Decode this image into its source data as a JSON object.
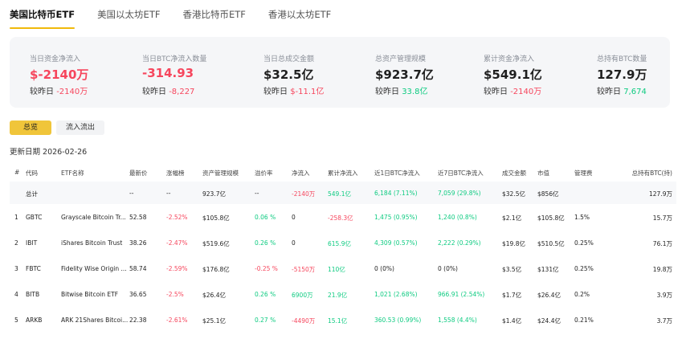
{
  "tabs": [
    "美国比特币ETF",
    "美国以太坊ETF",
    "香港比特币ETF",
    "香港以太坊ETF"
  ],
  "colors": {
    "up": "#0ecb81",
    "down": "#f6465d",
    "accent": "#f0b90b"
  },
  "summary": [
    {
      "label": "当日资金净流入",
      "value": "$-2140万",
      "cmp_label": "较昨日",
      "cmp_value": "-2140万",
      "value_color": "red",
      "cmp_color": "red"
    },
    {
      "label": "当日BTC净流入数量",
      "value": "-314.93",
      "cmp_label": "较昨日",
      "cmp_value": "-8,227",
      "value_color": "red",
      "cmp_color": "red"
    },
    {
      "label": "当日总成交金额",
      "value": "$32.5亿",
      "cmp_label": "较昨日",
      "cmp_value": "$-11.1亿",
      "value_color": "dark",
      "cmp_color": "red"
    },
    {
      "label": "总资产管理规模",
      "value": "$923.7亿",
      "cmp_label": "较昨日",
      "cmp_value": "33.8亿",
      "value_color": "dark",
      "cmp_color": "green"
    },
    {
      "label": "累计资金净流入",
      "value": "$549.1亿",
      "cmp_label": "较昨日",
      "cmp_value": "-2140万",
      "value_color": "dark",
      "cmp_color": "red"
    },
    {
      "label": "总持有BTC数量",
      "value": "127.9万",
      "cmp_label": "较昨日",
      "cmp_value": "7,674",
      "value_color": "dark",
      "cmp_color": "green"
    }
  ],
  "buttons": {
    "overview": "总览",
    "flows": "流入流出"
  },
  "update_date": "更新日期 2026-02-26",
  "table": {
    "headers": [
      "#",
      "代码",
      "ETF名称",
      "最新价",
      "涨幅榜",
      "资产管理规模",
      "溢价率",
      "净流入",
      "累计净流入",
      "近1日BTC净流入",
      "近7日BTC净流入",
      "成交金额",
      "市值",
      "管理费",
      "总持有BTC(持)"
    ],
    "total": [
      "",
      "总计",
      "",
      "--",
      "--",
      "923.7亿",
      "--",
      "-2140万",
      "549.1亿",
      "6,184 (7.11%)",
      "7,059 (29.8%)",
      "$32.5亿",
      "$856亿",
      "",
      "127.9万"
    ],
    "rows": [
      [
        "1",
        "GBTC",
        "Grayscale Bitcoin Tr...",
        "52.58",
        "-2.52%",
        "$105.8亿",
        "0.06 %",
        "0",
        "-258.3亿",
        "1,475 (0.95%)",
        "1,240 (0.8%)",
        "$2.1亿",
        "$105.8亿",
        "1.5%",
        "15.7万"
      ],
      [
        "2",
        "IBIT",
        "iShares Bitcoin Trust",
        "38.26",
        "-2.47%",
        "$519.6亿",
        "0.26 %",
        "0",
        "615.9亿",
        "4,309 (0.57%)",
        "2,222 (0.29%)",
        "$19.8亿",
        "$510.5亿",
        "0.25%",
        "76.1万"
      ],
      [
        "3",
        "FBTC",
        "Fidelity Wise Origin ...",
        "58.74",
        "-2.59%",
        "$176.8亿",
        "-0.25 %",
        "-5150万",
        "110亿",
        "0 (0%)",
        "0 (0%)",
        "$3.5亿",
        "$131亿",
        "0.25%",
        "19.8万"
      ],
      [
        "4",
        "BITB",
        "Bitwise Bitcoin ETF",
        "36.65",
        "-2.5%",
        "$26.4亿",
        "0.26 %",
        "6900万",
        "21.9亿",
        "1,021 (2.68%)",
        "966.91 (2.54%)",
        "$1.7亿",
        "$26.4亿",
        "0.2%",
        "3.9万"
      ],
      [
        "5",
        "ARKB",
        "ARK 21Shares Bitcoi...",
        "22.38",
        "-2.61%",
        "$25.1亿",
        "0.27 %",
        "-4490万",
        "15.1亿",
        "360.53 (0.99%)",
        "1,558 (4.4%)",
        "$1.4亿",
        "$24.4亿",
        "0.21%",
        "3.7万"
      ]
    ],
    "total_colors": [
      "",
      "",
      "",
      "",
      "",
      "",
      "",
      "red",
      "green",
      "green",
      "green",
      "",
      "",
      "",
      ""
    ],
    "row_colors": [
      [
        "",
        "",
        "",
        "",
        "red",
        "",
        "green",
        "",
        "red",
        "green",
        "green",
        "",
        "",
        "",
        ""
      ],
      [
        "",
        "",
        "",
        "",
        "red",
        "",
        "green",
        "",
        "green",
        "green",
        "green",
        "",
        "",
        "",
        ""
      ],
      [
        "",
        "",
        "",
        "",
        "red",
        "",
        "red",
        "red",
        "green",
        "",
        "",
        "",
        "",
        "",
        ""
      ],
      [
        "",
        "",
        "",
        "",
        "red",
        "",
        "green",
        "green",
        "green",
        "green",
        "green",
        "",
        "",
        "",
        ""
      ],
      [
        "",
        "",
        "",
        "",
        "red",
        "",
        "green",
        "red",
        "green",
        "green",
        "green",
        "",
        "",
        "",
        ""
      ]
    ]
  }
}
